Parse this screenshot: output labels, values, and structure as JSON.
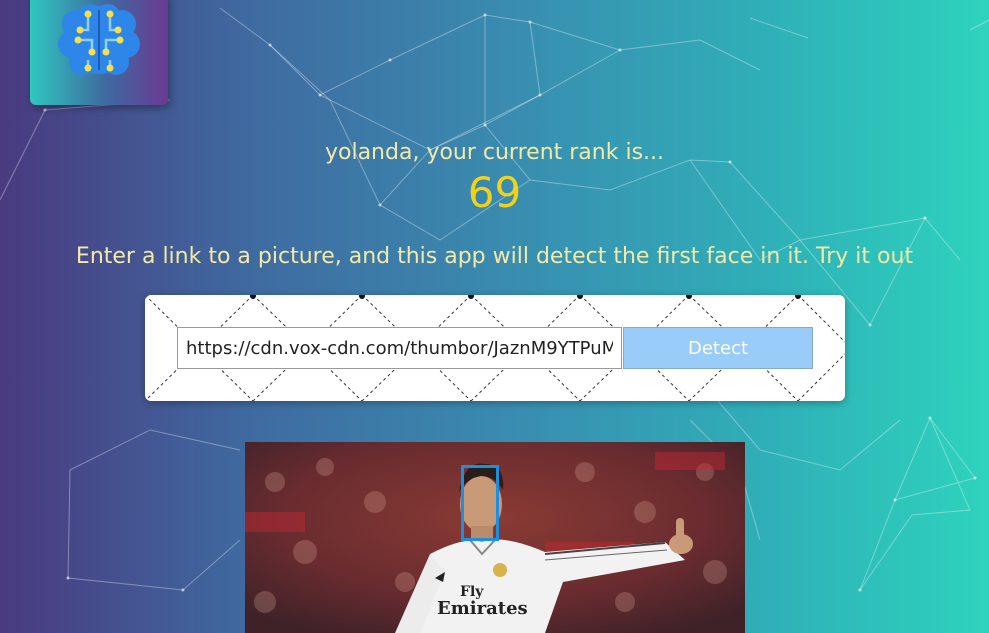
{
  "logo": {
    "icon": "brain-circuit-icon"
  },
  "rank": {
    "message": "yolanda, your current rank is...",
    "value": "69"
  },
  "instruction": "Enter a link to a picture, and this app will detect the first face in it. Try it out",
  "form": {
    "url_value": "https://cdn.vox-cdn.com/thumbor/JaznM9YTPuM",
    "detect_label": "Detect"
  },
  "photo": {
    "shirt_line1": "Fly",
    "shirt_line2": "Emirates"
  },
  "colors": {
    "rank_value": "#f0d21b",
    "text": "#f3e9a8",
    "detect_button": "#99ccf9",
    "face_box": "#1b8fe0"
  }
}
